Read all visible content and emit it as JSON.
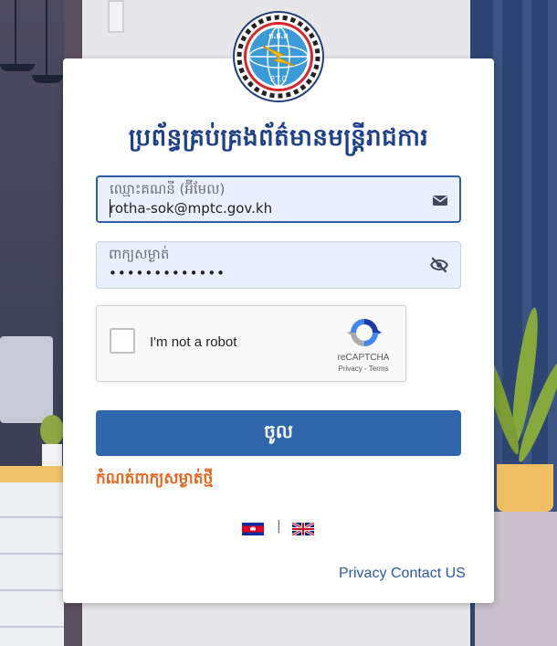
{
  "title": "ប្រព័ន្ធគ្រប់គ្រងព័ត៌មានមន្ត្រីរាជការ",
  "logo": {
    "text_top": "ប.ផ.ត",
    "text_bottom": "P.T.C"
  },
  "email_field": {
    "label": "ឈ្មោះគណនី (អ៊ីមែល)",
    "value": "rotha-sok@mptc.gov.kh",
    "icon": "envelope-icon"
  },
  "password_field": {
    "label": "ពាក្យសម្ងាត់",
    "value": "•••••••••••••",
    "icon": "eye-slash-icon"
  },
  "recaptcha": {
    "label": "I'm not a robot",
    "brand": "reCAPTCHA",
    "privacy": "Privacy",
    "sep": "-",
    "terms": "Terms"
  },
  "submit_label": "ចូល",
  "reset_link": "កំណត់ពាក្យសម្ងាត់ថ្មី",
  "languages": {
    "separator": "|",
    "km": "Khmer flag",
    "en": "UK flag"
  },
  "footer": {
    "privacy": "Privacy",
    "contact": "Contact US"
  },
  "colors": {
    "brand": "#2f67ad",
    "title": "#1e3f8a",
    "link_orange": "#e8661c",
    "field_bg": "#e8f0fe"
  }
}
